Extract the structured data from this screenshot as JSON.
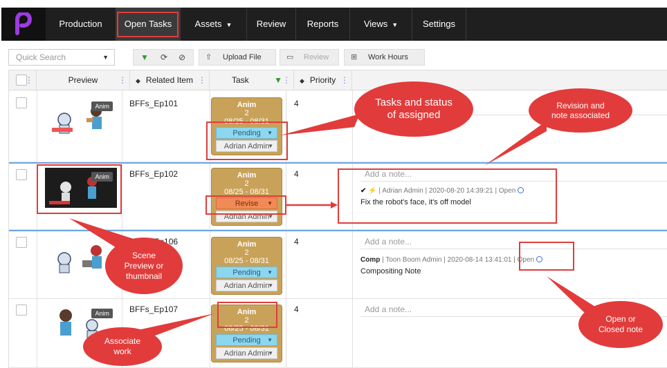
{
  "nav": {
    "items": [
      {
        "label": "Production",
        "caret": false
      },
      {
        "label": "Open Tasks",
        "caret": false,
        "active": true
      },
      {
        "label": "Assets",
        "caret": true
      },
      {
        "label": "Review",
        "caret": false
      },
      {
        "label": "Reports",
        "caret": false
      },
      {
        "label": "Views",
        "caret": true
      },
      {
        "label": "Settings",
        "caret": false
      }
    ],
    "logo_icon": "brand-p-icon",
    "accent_color": "#8a2bd6"
  },
  "toolbar": {
    "search_placeholder": "Quick Search",
    "upload_label": "Upload File",
    "review_label": "Review",
    "work_hours_label": "Work Hours"
  },
  "table": {
    "headers": {
      "preview": "Preview",
      "related": "Related Item",
      "task": "Task",
      "priority": "Priority"
    },
    "rows": [
      {
        "related": "BFFs_Ep101",
        "task_type": "Anim",
        "task_count": "2",
        "dates": "08/25 - 08/31",
        "status": "Pending",
        "assignee": "Adrian Admin",
        "priority": "4",
        "thumb_tag": "Anim"
      },
      {
        "related": "BFFs_Ep102",
        "task_type": "Anim",
        "task_count": "2",
        "dates": "08/25 - 08/31",
        "status": "Revise",
        "assignee": "Adrian Admin",
        "priority": "4",
        "thumb_tag": "Anim",
        "note_placeholder": "Add a note...",
        "note_meta": "| Adrian Admin | 2020-08-20 14:39:21 | Open",
        "note_text": "Fix the robot's face, it's off model"
      },
      {
        "related": "BFFs_Ep106",
        "task_type": "Anim",
        "task_count": "2",
        "dates": "08/25 - 08/31",
        "status": "Pending",
        "assignee": "Adrian Admin",
        "priority": "4",
        "note_placeholder": "Add a note...",
        "note_tag": "Comp",
        "note_meta": "| Toon Boom Admin | 2020-08-14 13:41:01 | Open",
        "note_text": "Compositing Note"
      },
      {
        "related": "BFFs_Ep107",
        "task_type": "Anim",
        "task_count": "2",
        "dates": "08/25 - 08/31",
        "status": "Pending",
        "assignee": "Adrian Admin",
        "priority": "4",
        "thumb_tag": "Anim",
        "note_placeholder": "Add a note..."
      }
    ]
  },
  "annotations": {
    "tasks_status": "Tasks and status of assigned",
    "revision_note": "Revision and note associated",
    "scene_preview": "Scene Preview or thumbnail",
    "associate_work": "Associate work",
    "open_closed": "Open or Closed note"
  }
}
